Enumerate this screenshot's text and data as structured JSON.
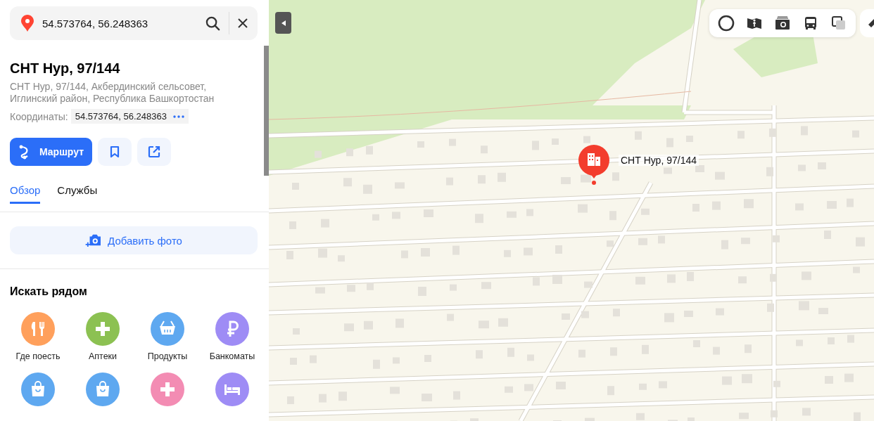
{
  "search": {
    "value": "54.573764, 56.248363"
  },
  "place": {
    "title": "СНТ Нур, 97/144",
    "address": "СНТ Нур, 97/144, Акбердинский сельсовет, Иглинский район, Республика Башкортостан",
    "coordinates_label": "Координаты:",
    "coordinates": "54.573764, 56.248363"
  },
  "actions": {
    "route": "Маршрут"
  },
  "tabs": [
    {
      "label": "Обзор",
      "selected": true
    },
    {
      "label": "Службы",
      "selected": false
    }
  ],
  "add_photo": "Добавить фото",
  "nearby": {
    "title": "Искать рядом",
    "categories": [
      {
        "kind": "food",
        "label": "Где поесть",
        "color": "#ffa05c"
      },
      {
        "kind": "plus",
        "label": "Аптеки",
        "color": "#8cc152"
      },
      {
        "kind": "basket",
        "label": "Продукты",
        "color": "#5ea8f0"
      },
      {
        "kind": "ruble",
        "label": "Банкоматы",
        "color": "#9e8cf5"
      },
      {
        "kind": "bag",
        "color": "#5ea8f0"
      },
      {
        "kind": "bag",
        "color": "#5ea8f0"
      },
      {
        "kind": "plus",
        "color": "#f38cb3"
      },
      {
        "kind": "bed",
        "color": "#9e8cf5"
      }
    ]
  },
  "map": {
    "marker": {
      "label": "СНТ Нур, 97/144"
    }
  }
}
